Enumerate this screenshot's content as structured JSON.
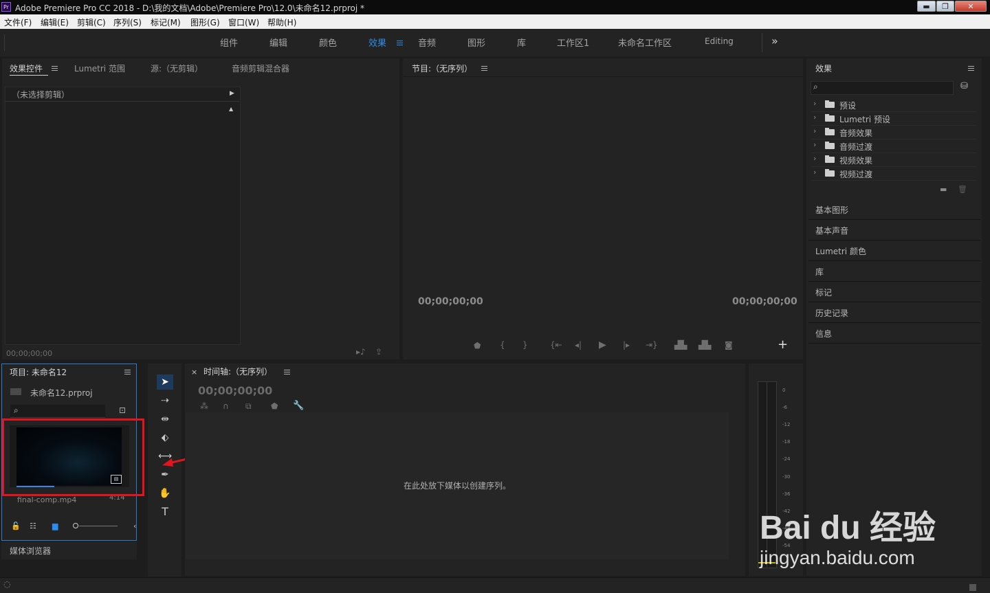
{
  "window": {
    "title": "Adobe Premiere Pro CC 2018 - D:\\我的文档\\Adobe\\Premiere Pro\\12.0\\未命名12.prproj *",
    "app_icon": "Pr",
    "minimize": "▬",
    "maximize": "❐",
    "close": "✕"
  },
  "menu": [
    "文件(F)",
    "编辑(E)",
    "剪辑(C)",
    "序列(S)",
    "标记(M)",
    "图形(G)",
    "窗口(W)",
    "帮助(H)"
  ],
  "workspaces": {
    "items": [
      "组件",
      "编辑",
      "颜色",
      "效果",
      "音频",
      "图形",
      "库",
      "工作区1",
      "未命名工作区",
      "Editing"
    ],
    "active": "效果",
    "more": "»"
  },
  "source_panel": {
    "tabs": [
      "效果控件",
      "Lumetri 范围",
      "源:（无剪辑）",
      "音频剪辑混合器"
    ],
    "no_clip": "（未选择剪辑）",
    "timecode": "00;00;00;00"
  },
  "program_panel": {
    "title": "节目:（无序列）",
    "timecode_left": "00;00;00;00",
    "timecode_right": "00;00;00;00",
    "add_button": "+"
  },
  "effects_panel": {
    "title": "效果",
    "items": [
      "预设",
      "Lumetri 预设",
      "音频效果",
      "音频过渡",
      "视频效果",
      "视频过渡"
    ]
  },
  "right_sections": [
    "基本图形",
    "基本声音",
    "Lumetri 颜色",
    "库",
    "标记",
    "历史记录",
    "信息"
  ],
  "project_panel": {
    "title": "项目: 未命名12",
    "file": "未命名12.prproj",
    "clip_name": "final-comp.mp4",
    "clip_duration": "4:14",
    "media_browser": "媒体浏览器"
  },
  "timeline": {
    "title": "时间轴:（无序列）",
    "close": "×",
    "timecode": "00;00;00;00",
    "drop_hint": "在此处放下媒体以创建序列。"
  },
  "tools": [
    "selection-tool",
    "track-select-tool",
    "ripple-edit-tool",
    "razor-tool",
    "slip-tool",
    "pen-tool",
    "hand-tool",
    "type-tool"
  ],
  "meter_labels": [
    "0",
    "-6",
    "-12",
    "-18",
    "-24",
    "-30",
    "-36",
    "-42",
    "-48",
    "-54"
  ],
  "watermark": {
    "logo": "Bai du 经验",
    "url": "jingyan.baidu.com"
  },
  "colors": {
    "accent": "#2d8ceb",
    "highlight_box": "#e3141e",
    "panel_bg": "#232323"
  }
}
